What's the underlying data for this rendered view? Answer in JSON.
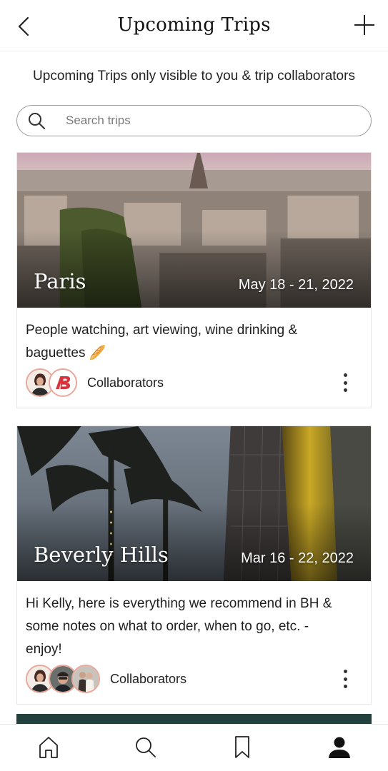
{
  "header": {
    "title": "Upcoming Trips",
    "back_icon": "chevron-left-icon",
    "add_icon": "plus-icon"
  },
  "notice": "Upcoming Trips only visible to you & trip collaborators",
  "search": {
    "placeholder": "Search trips",
    "icon": "search-icon"
  },
  "trips": [
    {
      "name": "Paris",
      "dates": "May 18 - 21, 2022",
      "description": "People watching, art viewing, wine drinking & baguettes 🥖",
      "collaborators_label": "Collaborators",
      "avatar_count": 2
    },
    {
      "name": "Beverly Hills",
      "dates": "Mar 16 - 22, 2022",
      "description": "Hi Kelly, here is everything we recommend in BH & some notes on what to order, when to go, etc. - enjoy!",
      "collaborators_label": "Collaborators",
      "avatar_count": 3
    }
  ],
  "tabbar": {
    "tabs": [
      "home-icon",
      "search-icon",
      "bookmark-icon",
      "profile-icon"
    ],
    "active": "profile-icon"
  },
  "colors": {
    "avatar_ring": "#e9a79a",
    "text": "#1a1a1a"
  }
}
